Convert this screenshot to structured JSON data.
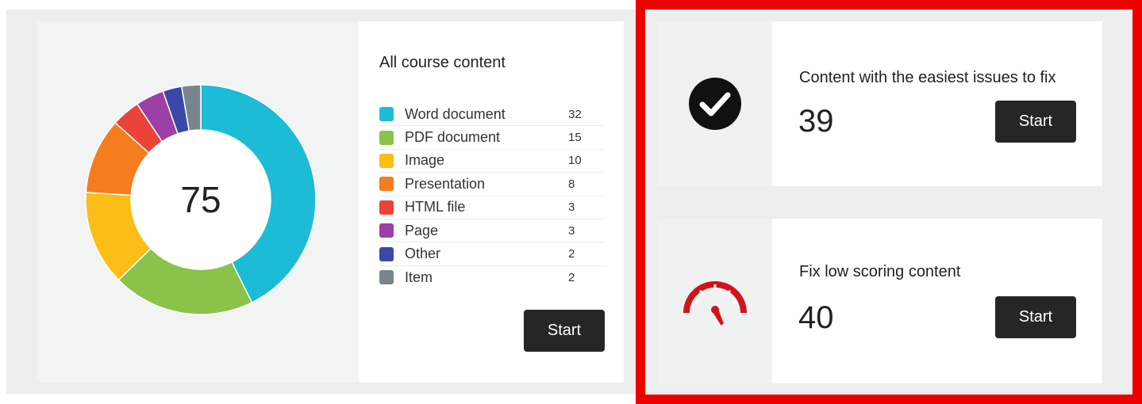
{
  "donut": {
    "total": "75"
  },
  "content": {
    "title": "All course content",
    "items": [
      {
        "label": "Word document",
        "count": "32",
        "color": "#1cbcd6"
      },
      {
        "label": "PDF document",
        "count": "15",
        "color": "#8bc34a"
      },
      {
        "label": "Image",
        "count": "10",
        "color": "#fbbd16"
      },
      {
        "label": "Presentation",
        "count": "8",
        "color": "#f57c1f"
      },
      {
        "label": "HTML file",
        "count": "3",
        "color": "#eb4339"
      },
      {
        "label": "Page",
        "count": "3",
        "color": "#9c3fa6"
      },
      {
        "label": "Other",
        "count": "2",
        "color": "#3b48a8"
      },
      {
        "label": "Item",
        "count": "2",
        "color": "#79858c"
      }
    ],
    "start_label": "Start"
  },
  "tasks": [
    {
      "title": "Content with the easiest issues to fix",
      "count": "39",
      "icon": "checkmark-circle-icon",
      "start_label": "Start"
    },
    {
      "title": "Fix low scoring content",
      "count": "40",
      "icon": "gauge-icon",
      "start_label": "Start"
    }
  ],
  "colors": {
    "highlight": "#ee0000",
    "button": "#262626",
    "gauge": "#d0141c"
  }
}
